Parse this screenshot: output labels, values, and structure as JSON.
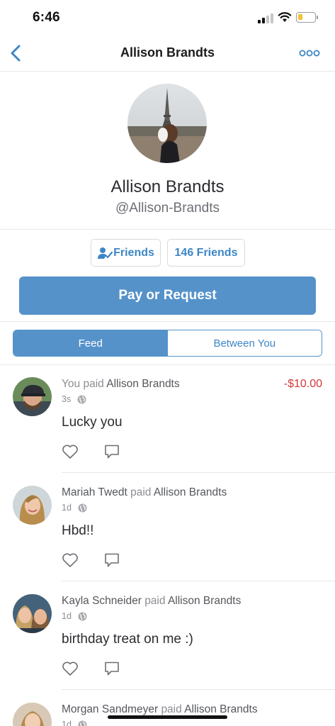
{
  "status_bar": {
    "time": "6:46"
  },
  "nav": {
    "title": "Allison Brandts"
  },
  "profile": {
    "name": "Allison Brandts",
    "username": "@Allison-Brandts"
  },
  "actions": {
    "friends_label": "Friends",
    "friend_count_label": "146 Friends",
    "pay_label": "Pay or Request"
  },
  "tabs": {
    "feed": "Feed",
    "between": "Between You"
  },
  "feed": [
    {
      "actor": "You",
      "verb": "paid",
      "target": "Allison Brandts",
      "time": "3s",
      "message": "Lucky you",
      "amount": "-$10.00"
    },
    {
      "actor": "Mariah Twedt",
      "verb": "paid",
      "target": "Allison Brandts",
      "time": "1d",
      "message": "Hbd!!",
      "amount": ""
    },
    {
      "actor": "Kayla Schneider",
      "verb": "paid",
      "target": "Allison Brandts",
      "time": "1d",
      "message": "birthday treat on me :)",
      "amount": ""
    },
    {
      "actor": "Morgan Sandmeyer",
      "verb": "paid",
      "target": "Allison Brandts",
      "time": "1d",
      "message": "",
      "amount": ""
    }
  ],
  "colors": {
    "accent": "#5592c9",
    "link": "#3d86c6",
    "negative_amount": "#d0393e"
  },
  "icons": [
    "back-icon",
    "more-icon",
    "friend-check-icon",
    "globe-icon",
    "heart-icon",
    "comment-icon"
  ]
}
